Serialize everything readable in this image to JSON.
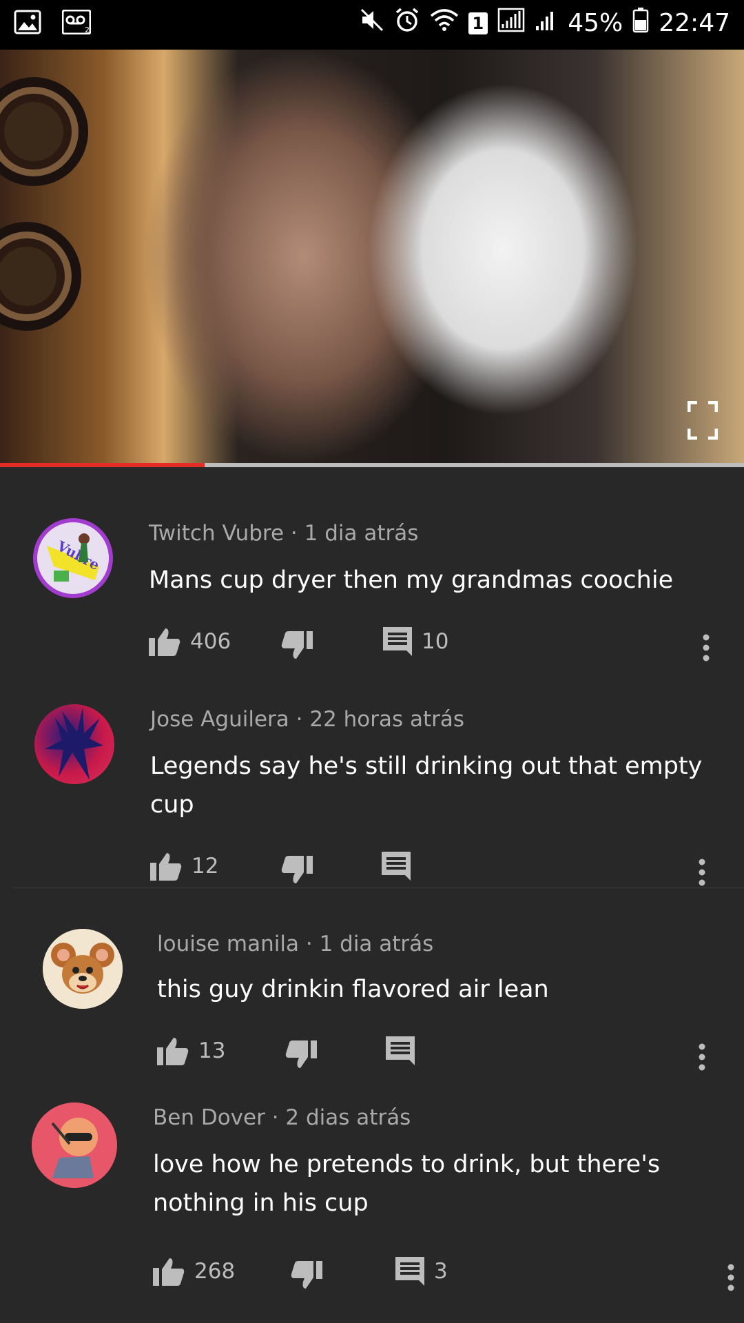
{
  "status_bar": {
    "battery": "45%",
    "time": "22:47",
    "sim_badge": "1"
  },
  "video": {
    "progress": 0.275
  },
  "comments": [
    {
      "author": "Twitch Vubre",
      "time": "1 dia atrás",
      "text": "Mans cup dryer then my grandmas coochie",
      "likes": "406",
      "replies": "10",
      "avatar_text": "Vubre"
    },
    {
      "author": "Jose Aguilera",
      "time": "22 horas atrás",
      "text": "Legends say he's still drinking out that empty cup",
      "likes": "12",
      "replies": ""
    },
    {
      "author": "louise manila",
      "time": "1 dia atrás",
      "text": "this guy drinkin flavored air lean",
      "likes": "13",
      "replies": ""
    },
    {
      "author": "Ben Dover",
      "time": "2 dias atrás",
      "text": "love how he pretends to drink, but there's nothing in his cup",
      "likes": "268",
      "replies": "3"
    }
  ],
  "icons": {
    "like": "thumb-up-icon",
    "dislike": "thumb-down-icon",
    "reply": "comment-icon",
    "more": "more-vert-icon"
  }
}
